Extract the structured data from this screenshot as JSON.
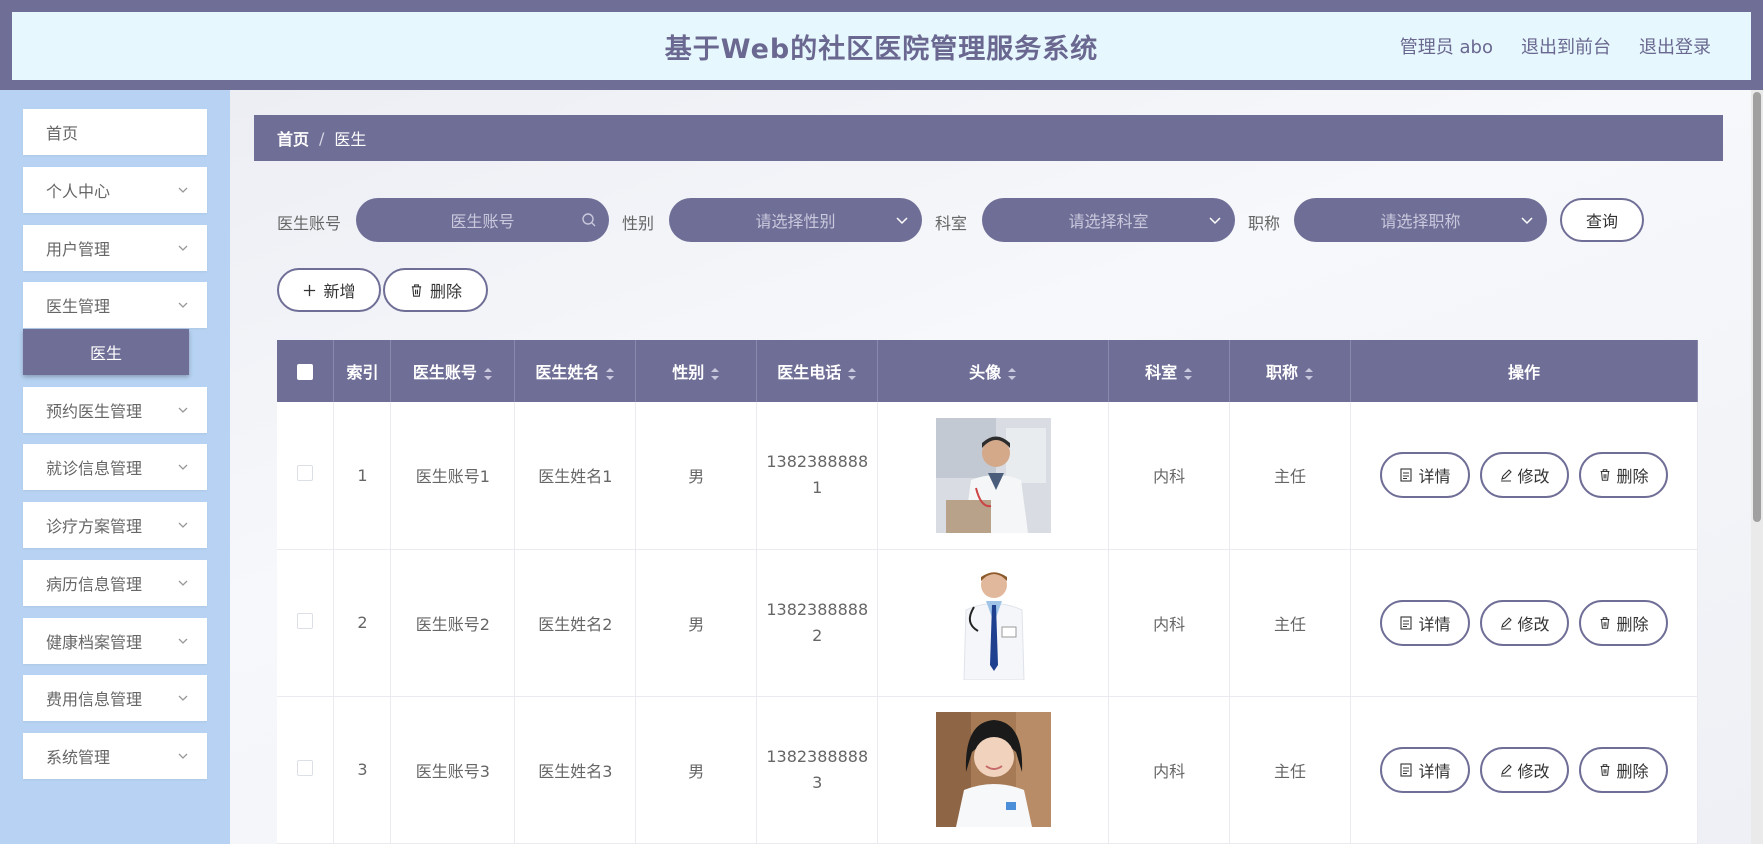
{
  "header": {
    "title": "基于Web的社区医院管理服务系统",
    "admin_label": "管理员 abo",
    "to_front": "退出到前台",
    "logout": "退出登录"
  },
  "sidebar": {
    "items": [
      {
        "label": "首页"
      },
      {
        "label": "个人中心"
      },
      {
        "label": "用户管理"
      },
      {
        "label": "医生管理"
      },
      {
        "label": "预约医生管理"
      },
      {
        "label": "就诊信息管理"
      },
      {
        "label": "诊疗方案管理"
      },
      {
        "label": "病历信息管理"
      },
      {
        "label": "健康档案管理"
      },
      {
        "label": "费用信息管理"
      },
      {
        "label": "系统管理"
      }
    ],
    "active_sub": "医生"
  },
  "breadcrumb": {
    "home": "首页",
    "sep": "/",
    "current": "医生"
  },
  "filters": {
    "account_label": "医生账号",
    "account_placeholder": "医生账号",
    "gender_label": "性别",
    "gender_placeholder": "请选择性别",
    "dept_label": "科室",
    "dept_placeholder": "请选择科室",
    "title_label": "职称",
    "title_placeholder": "请选择职称",
    "query_button": "查询"
  },
  "actions": {
    "add": "新增",
    "delete": "删除"
  },
  "table": {
    "columns": [
      "索引",
      "医生账号",
      "医生姓名",
      "性别",
      "医生电话",
      "头像",
      "科室",
      "职称",
      "操作"
    ],
    "rows": [
      {
        "index": "1",
        "account": "医生账号1",
        "name": "医生姓名1",
        "gender": "男",
        "phone_a": "1382388888",
        "phone_b": "1",
        "dept": "内科",
        "title": "主任"
      },
      {
        "index": "2",
        "account": "医生账号2",
        "name": "医生姓名2",
        "gender": "男",
        "phone_a": "1382388888",
        "phone_b": "2",
        "dept": "内科",
        "title": "主任"
      },
      {
        "index": "3",
        "account": "医生账号3",
        "name": "医生姓名3",
        "gender": "男",
        "phone_a": "1382388888",
        "phone_b": "3",
        "dept": "内科",
        "title": "主任"
      }
    ],
    "op_detail": "详情",
    "op_edit": "修改",
    "op_delete": "删除"
  },
  "colors": {
    "accent": "#6f6e96",
    "header_bg": "#e6f7fd",
    "sidebar_bg": "#b7d2f2"
  }
}
